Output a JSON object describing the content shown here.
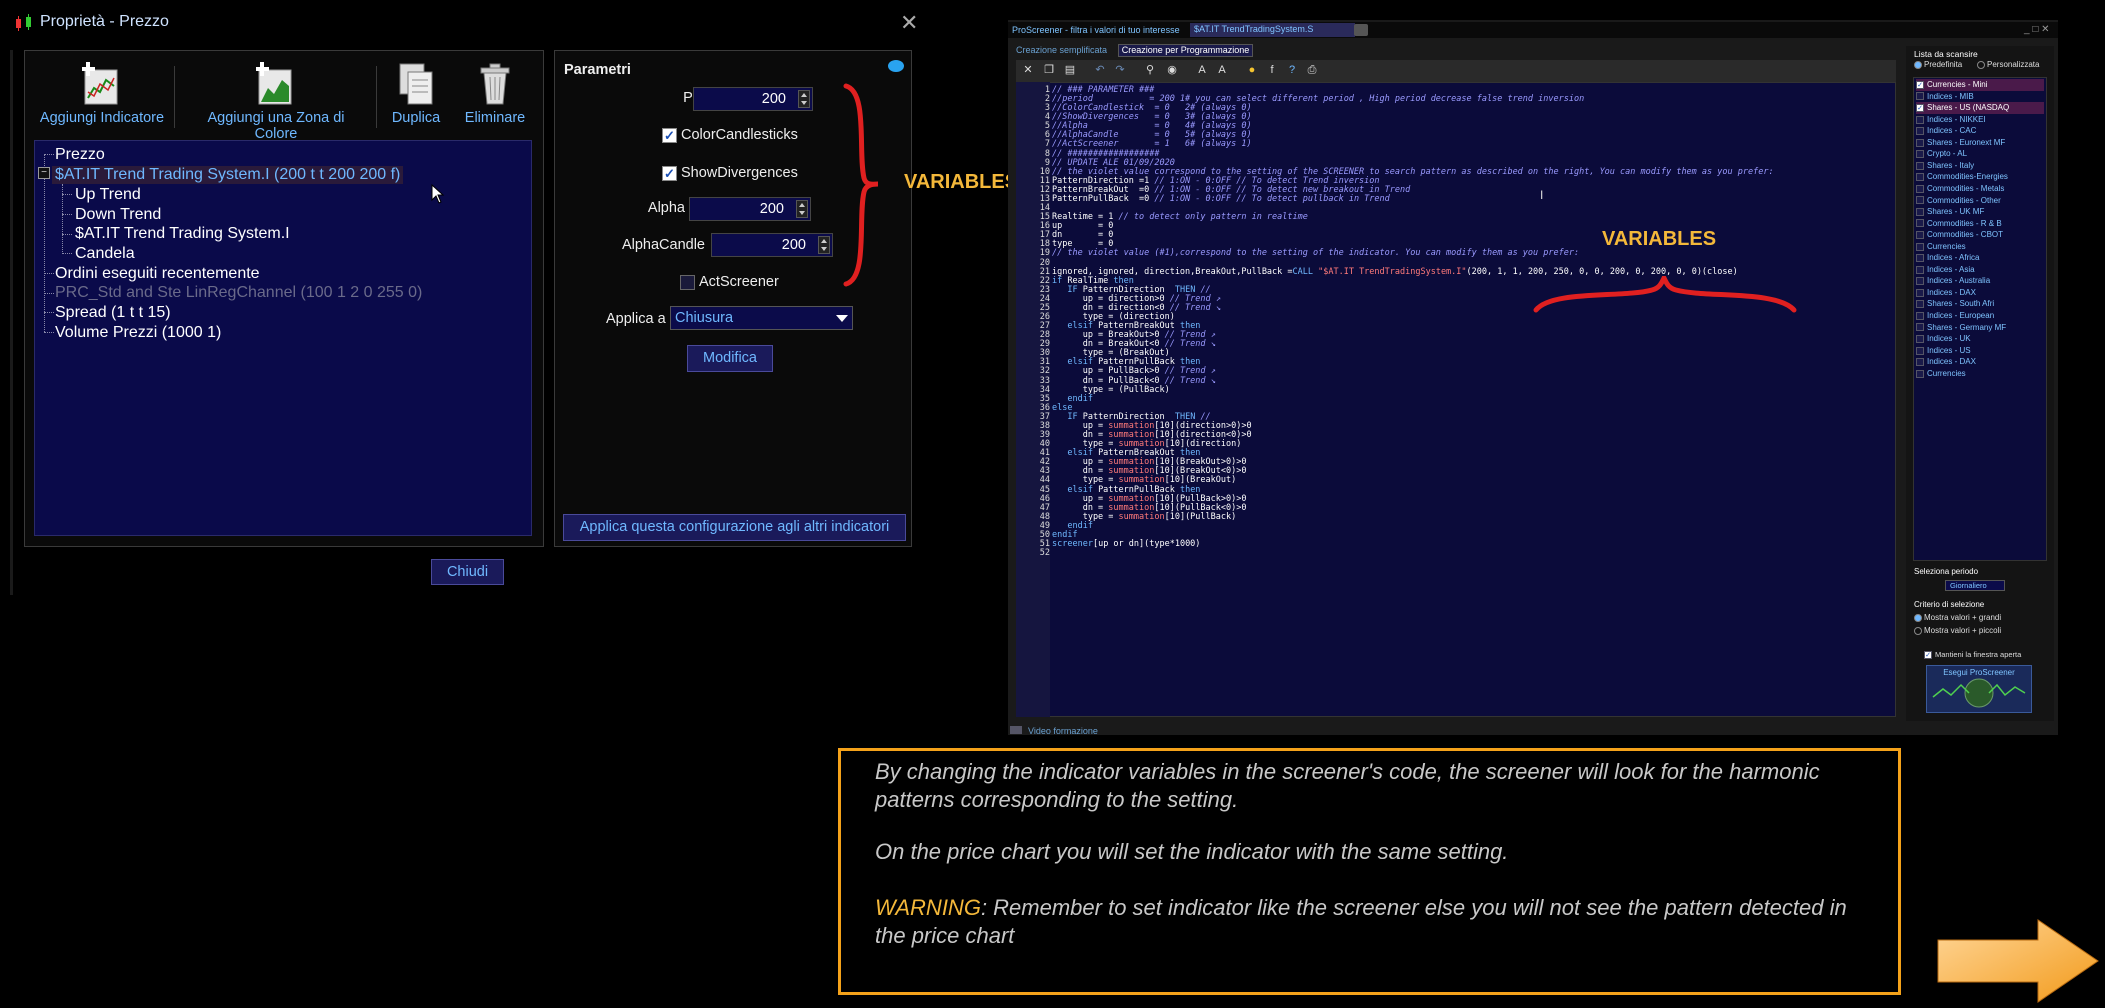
{
  "dialog": {
    "title": "Proprietà - Prezzo",
    "close": "✕",
    "toolbar": {
      "add_indicator": "Aggiungi Indicatore",
      "add_color_zone": "Aggiungi una Zona di Colore",
      "duplicate": "Duplica",
      "delete": "Eliminare"
    },
    "tree": {
      "root": "Prezzo",
      "selected": "$AT.IT Trend Trading System.I (200 t t 200 200 f)",
      "children": [
        "Up Trend",
        "Down Trend",
        "$AT.IT Trend Trading System.I",
        "Candela"
      ],
      "siblings": [
        "Ordini eseguiti recentemente",
        "PRC_Std and Ste LinRegChannel (100 1 2 0 255 0)",
        "Spread (1 t t 15)",
        "Volume Prezzi (1000 1)"
      ]
    },
    "params": {
      "title": "Parametri",
      "period_label": "Period",
      "period_value": "200",
      "color_candlesticks": "ColorCandlesticks",
      "show_divergences": "ShowDivergences",
      "alpha_label": "Alpha",
      "alpha_value": "200",
      "alphacandle_label": "AlphaCandle",
      "alphacandle_value": "200",
      "act_screener": "ActScreener",
      "apply_to_label": "Applica a",
      "apply_to_value": "Chiusura",
      "modify_button": "Modifica",
      "apply_all_button": "Applica questa configurazione agli altri indicatori"
    },
    "close_button": "Chiudi",
    "variables_label": "VARIABLES"
  },
  "editor": {
    "title": "ProScreener - filtra i valori di tuo interesse",
    "title_tab": "$AT.IT TrendTradingSystem.S",
    "win_controls": "_ □ ✕",
    "tab_simple": "Creazione semplificata",
    "tab_programming": "Creazione per Programmazione",
    "variables_label": "VARIABLES",
    "bottom_link": "Video formazione",
    "code_lines": [
      [
        {
          "t": "// ### PARAMETER ###",
          "c": "c-cm"
        }
      ],
      [
        {
          "t": "//period           = 200 1# you can select different period , High period decrease false trend inversion",
          "c": "c-cm"
        }
      ],
      [
        {
          "t": "//ColorCandlestick  = 0   2# (always 0)",
          "c": "c-cm"
        }
      ],
      [
        {
          "t": "//ShowDivergences   = 0   3# (always 0)",
          "c": "c-cm"
        }
      ],
      [
        {
          "t": "//Alpha             = 0   4# (always 0)",
          "c": "c-cm"
        }
      ],
      [
        {
          "t": "//AlphaCandle       = 0   5# (always 0)",
          "c": "c-cm"
        }
      ],
      [
        {
          "t": "//ActScreener       = 1   6# (always 1)",
          "c": "c-cm"
        }
      ],
      [
        {
          "t": "// ##################",
          "c": "c-cm"
        }
      ],
      [
        {
          "t": "// UPDATE ALE 01/09/2020",
          "c": "c-cm"
        }
      ],
      [
        {
          "t": "// the violet value correspond to the setting of the SCREENER to search pattern as described on the right, You can modify them as you prefer:",
          "c": "c-cm"
        }
      ],
      [
        {
          "t": "PatternDirection =1 ",
          "c": "c-tx"
        },
        {
          "t": "// 1:ON - 0:OFF // To detect Trend inversion",
          "c": "c-cm"
        }
      ],
      [
        {
          "t": "PatternBreakOut  =0 ",
          "c": "c-tx"
        },
        {
          "t": "// 1:ON - 0:OFF // To detect new breakout in Trend",
          "c": "c-cm"
        }
      ],
      [
        {
          "t": "PatternPullBack  =0 ",
          "c": "c-tx"
        },
        {
          "t": "// 1:ON - 0:OFF // To detect pullback in Trend",
          "c": "c-cm"
        }
      ],
      [
        {
          "t": "",
          "c": "c-tx"
        }
      ],
      [
        {
          "t": "Realtime = 1 ",
          "c": "c-tx"
        },
        {
          "t": "// to detect only pattern in realtime",
          "c": "c-cm"
        }
      ],
      [
        {
          "t": "up       = 0",
          "c": "c-tx"
        }
      ],
      [
        {
          "t": "dn       = 0",
          "c": "c-tx"
        }
      ],
      [
        {
          "t": "type     = 0",
          "c": "c-tx"
        }
      ],
      [
        {
          "t": "// the violet value (#1),correspond to the setting of the indicator. You can modify them as you prefer:",
          "c": "c-cm"
        }
      ],
      [
        {
          "t": "",
          "c": "c-tx"
        }
      ],
      [
        {
          "t": "ignored, ignored, direction,BreakOut,PullBack =",
          "c": "c-tx"
        },
        {
          "t": "CALL ",
          "c": "c-kw"
        },
        {
          "t": "\"$AT.IT TrendTradingSystem.I\"",
          "c": "c-str"
        },
        {
          "t": "(200, 1, 1, 200, 250, 0, 0, 200, 0, 200, 0, 0)(close)",
          "c": "c-tx"
        }
      ],
      [
        {
          "t": "if ",
          "c": "c-kw"
        },
        {
          "t": "RealTime ",
          "c": "c-tx"
        },
        {
          "t": "then",
          "c": "c-kw"
        }
      ],
      [
        {
          "t": "   IF ",
          "c": "c-kw"
        },
        {
          "t": "PatternDirection  ",
          "c": "c-tx"
        },
        {
          "t": "THEN ",
          "c": "c-kw"
        },
        {
          "t": "//",
          "c": "c-cm"
        }
      ],
      [
        {
          "t": "      up = direction>0 ",
          "c": "c-tx"
        },
        {
          "t": "// Trend ↗",
          "c": "c-cm"
        }
      ],
      [
        {
          "t": "      dn = direction<0 ",
          "c": "c-tx"
        },
        {
          "t": "// Trend ↘",
          "c": "c-cm"
        }
      ],
      [
        {
          "t": "      type = (direction)",
          "c": "c-tx"
        }
      ],
      [
        {
          "t": "   elsif ",
          "c": "c-kw"
        },
        {
          "t": "PatternBreakOut ",
          "c": "c-tx"
        },
        {
          "t": "then",
          "c": "c-kw"
        }
      ],
      [
        {
          "t": "      up = BreakOut>0 ",
          "c": "c-tx"
        },
        {
          "t": "// Trend ↗",
          "c": "c-cm"
        }
      ],
      [
        {
          "t": "      dn = BreakOut<0 ",
          "c": "c-tx"
        },
        {
          "t": "// Trend ↘",
          "c": "c-cm"
        }
      ],
      [
        {
          "t": "      type = (BreakOut)",
          "c": "c-tx"
        }
      ],
      [
        {
          "t": "   elsif ",
          "c": "c-kw"
        },
        {
          "t": "PatternPullBack ",
          "c": "c-tx"
        },
        {
          "t": "then",
          "c": "c-kw"
        }
      ],
      [
        {
          "t": "      up = PullBack>0 ",
          "c": "c-tx"
        },
        {
          "t": "// Trend ↗",
          "c": "c-cm"
        }
      ],
      [
        {
          "t": "      dn = PullBack<0 ",
          "c": "c-tx"
        },
        {
          "t": "// Trend ↘",
          "c": "c-cm"
        }
      ],
      [
        {
          "t": "      type = (PullBack)",
          "c": "c-tx"
        }
      ],
      [
        {
          "t": "   endif",
          "c": "c-kw"
        }
      ],
      [
        {
          "t": "else",
          "c": "c-kw"
        }
      ],
      [
        {
          "t": "   IF ",
          "c": "c-kw"
        },
        {
          "t": "PatternDirection  ",
          "c": "c-tx"
        },
        {
          "t": "THEN ",
          "c": "c-kw"
        },
        {
          "t": "//",
          "c": "c-cm"
        }
      ],
      [
        {
          "t": "      up = ",
          "c": "c-tx"
        },
        {
          "t": "summation",
          "c": "c-fn"
        },
        {
          "t": "[10](direction>0)>0",
          "c": "c-tx"
        }
      ],
      [
        {
          "t": "      dn = ",
          "c": "c-tx"
        },
        {
          "t": "summation",
          "c": "c-fn"
        },
        {
          "t": "[10](direction<0)>0",
          "c": "c-tx"
        }
      ],
      [
        {
          "t": "      type = ",
          "c": "c-tx"
        },
        {
          "t": "summation",
          "c": "c-fn"
        },
        {
          "t": "[10](direction)",
          "c": "c-tx"
        }
      ],
      [
        {
          "t": "   elsif ",
          "c": "c-kw"
        },
        {
          "t": "PatternBreakOut ",
          "c": "c-tx"
        },
        {
          "t": "then",
          "c": "c-kw"
        }
      ],
      [
        {
          "t": "      up = ",
          "c": "c-tx"
        },
        {
          "t": "summation",
          "c": "c-fn"
        },
        {
          "t": "[10](BreakOut>0)>0",
          "c": "c-tx"
        }
      ],
      [
        {
          "t": "      dn = ",
          "c": "c-tx"
        },
        {
          "t": "summation",
          "c": "c-fn"
        },
        {
          "t": "[10](BreakOut<0)>0",
          "c": "c-tx"
        }
      ],
      [
        {
          "t": "      type = ",
          "c": "c-tx"
        },
        {
          "t": "summation",
          "c": "c-fn"
        },
        {
          "t": "[10](BreakOut)",
          "c": "c-tx"
        }
      ],
      [
        {
          "t": "   elsif ",
          "c": "c-kw"
        },
        {
          "t": "PatternPullBack ",
          "c": "c-tx"
        },
        {
          "t": "then",
          "c": "c-kw"
        }
      ],
      [
        {
          "t": "      up = ",
          "c": "c-tx"
        },
        {
          "t": "summation",
          "c": "c-fn"
        },
        {
          "t": "[10](PullBack>0)>0",
          "c": "c-tx"
        }
      ],
      [
        {
          "t": "      dn = ",
          "c": "c-tx"
        },
        {
          "t": "summation",
          "c": "c-fn"
        },
        {
          "t": "[10](PullBack<0)>0",
          "c": "c-tx"
        }
      ],
      [
        {
          "t": "      type = ",
          "c": "c-tx"
        },
        {
          "t": "summation",
          "c": "c-fn"
        },
        {
          "t": "[10](PullBack)",
          "c": "c-tx"
        }
      ],
      [
        {
          "t": "   endif",
          "c": "c-kw"
        }
      ],
      [
        {
          "t": "endif",
          "c": "c-kw"
        }
      ],
      [
        {
          "t": "screener",
          "c": "c-kw"
        },
        {
          "t": "[up or dn](type*1000)",
          "c": "c-tx"
        }
      ],
      [
        {
          "t": "",
          "c": "c-tx"
        }
      ]
    ],
    "sidebar": {
      "title": "Lista da scansire",
      "radio_predefined": "Predefinita",
      "radio_custom": "Personalizzata",
      "items": [
        {
          "label": "Currencies - Mini",
          "checked": true,
          "sel": true
        },
        {
          "label": "Indices - MIB",
          "checked": false,
          "sel": false
        },
        {
          "label": "Shares - US (NASDAQ",
          "checked": true,
          "sel": true
        },
        {
          "label": "Indices - NIKKEI",
          "checked": false,
          "sel": false
        },
        {
          "label": "Indices - CAC",
          "checked": false,
          "sel": false
        },
        {
          "label": "Shares - Euronext MF",
          "checked": false,
          "sel": false
        },
        {
          "label": "Crypto - AL",
          "checked": false,
          "sel": false
        },
        {
          "label": "Shares - Italy",
          "checked": false,
          "sel": false
        },
        {
          "label": "Commodities-Energies",
          "checked": false,
          "sel": false
        },
        {
          "label": "Commodities - Metals",
          "checked": false,
          "sel": false
        },
        {
          "label": "Commodities - Other",
          "checked": false,
          "sel": false
        },
        {
          "label": "Shares - UK MF",
          "checked": false,
          "sel": false
        },
        {
          "label": "Commodities - R & B",
          "checked": false,
          "sel": false
        },
        {
          "label": "Commodities - CBOT",
          "checked": false,
          "sel": false
        },
        {
          "label": "Currencies",
          "checked": false,
          "sel": false
        },
        {
          "label": "Indices - Africa",
          "checked": false,
          "sel": false
        },
        {
          "label": "Indices - Asia",
          "checked": false,
          "sel": false
        },
        {
          "label": "Indices - Australia",
          "checked": false,
          "sel": false
        },
        {
          "label": "Indices - DAX",
          "checked": false,
          "sel": false
        },
        {
          "label": "Shares - South Afri",
          "checked": false,
          "sel": false
        },
        {
          "label": "Indices - European",
          "checked": false,
          "sel": false
        },
        {
          "label": "Shares - Germany MF",
          "checked": false,
          "sel": false
        },
        {
          "label": "Indices - UK",
          "checked": false,
          "sel": false
        },
        {
          "label": "Indices - US",
          "checked": false,
          "sel": false
        },
        {
          "label": "Indices - DAX",
          "checked": false,
          "sel": false
        },
        {
          "label": "Currencies",
          "checked": false,
          "sel": false
        }
      ],
      "period_label": "Seleziona periodo",
      "period_value": "Giornaliero",
      "criteria_label": "Criterio di selezione",
      "criteria_high": "Mostra valori + grandi",
      "criteria_low": "Mostra valori + piccoli",
      "keep_open": "Mantieni la finestra aperta",
      "exec_button": "Esegui ProScreener"
    }
  },
  "info": {
    "p1": "By changing the indicator variables in the screener's code, the screener will look for the harmonic patterns corresponding to the setting.",
    "p2": "On the price chart you will set the indicator with the same setting.",
    "warn_word": "WARNING",
    "p3_rest": ": Remember to set indicator like the screener else you will not see the pattern detected in the price chart"
  },
  "colors": {
    "accent_orange": "#f4a21a",
    "variables_yellow": "#f4b83a",
    "brace_red": "#e02020",
    "link_blue": "#6fb8ff"
  }
}
